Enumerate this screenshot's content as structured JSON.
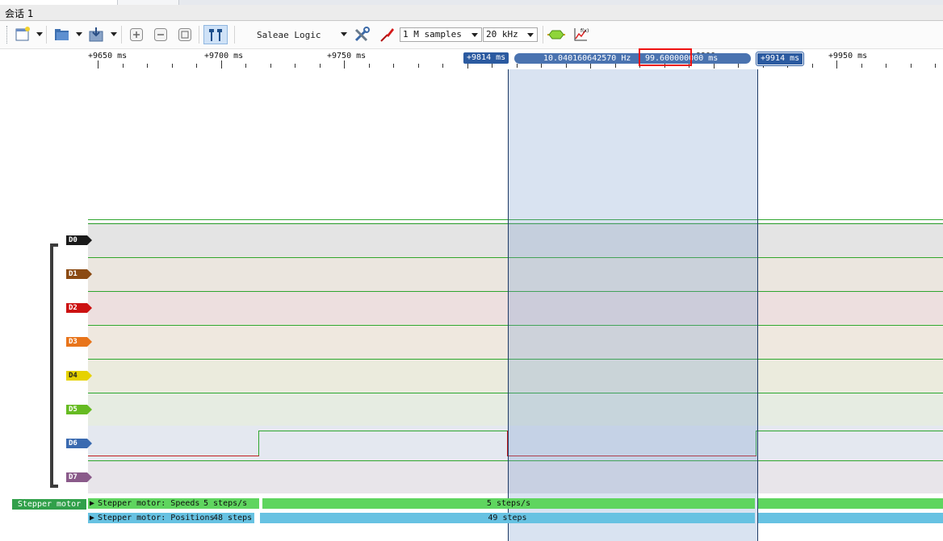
{
  "window": {
    "tab_title": "会话 1"
  },
  "toolbar": {
    "device_name": "Saleae Logic",
    "sample_depth": "1 M samples",
    "sample_rate": "20 kHz",
    "icons": [
      "new-document-icon",
      "open-folder-icon",
      "save-export-icon",
      "zoom-in-icon",
      "zoom-out-icon",
      "zoom-fit-icon",
      "cursor-pair-icon",
      "settings-tools-icon",
      "probe-icon",
      "analyzer-icon",
      "measurement-graph-icon"
    ]
  },
  "ruler": {
    "ticks": [
      "+9650 ms",
      "+9700 ms",
      "+9750 ms",
      "+9800 ms",
      "+9850 ms",
      "+9900 ms",
      "+9950 ms"
    ],
    "marker_a": "+9814 ms",
    "marker_b": "+9914 ms",
    "frequency": "10.040160642570 Hz",
    "period": "99.600000000 ms"
  },
  "channels": [
    "D0",
    "D1",
    "D2",
    "D3",
    "D4",
    "D5",
    "D6",
    "D7"
  ],
  "channel_colors": {
    "D0": "#1a1a1a",
    "D1": "#8b4a12",
    "D2": "#cc1111",
    "D3": "#e8741a",
    "D4": "#e6d200",
    "D5": "#66bb22",
    "D6": "#3a6ab0",
    "D7": "#8a5a8a"
  },
  "analyzers": {
    "group_label": "Stepper motor",
    "speeds": {
      "name": "Stepper motor: Speeds",
      "left_value": "5 steps/s",
      "main_value": "5 steps/s",
      "color": "#5fd55f"
    },
    "positions": {
      "name": "Stepper motor: Positions",
      "left_value": "48 steps",
      "main_value": "49 steps",
      "color": "#67c2e2"
    }
  }
}
